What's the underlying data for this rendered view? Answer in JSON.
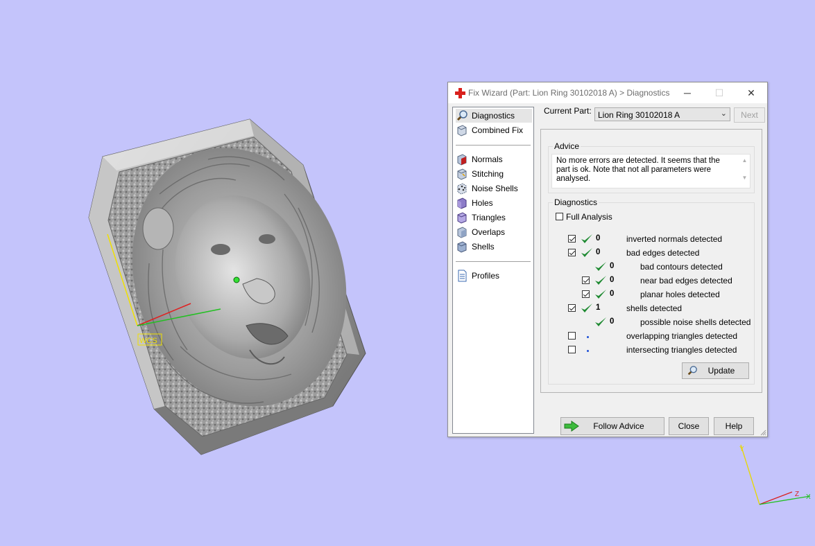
{
  "window": {
    "title": "Fix Wizard (Part: Lion Ring 30102018 A) > Diagnostics",
    "min_glyph": "─",
    "max_glyph": "☐",
    "close_glyph": "✕"
  },
  "sidebar": {
    "items": [
      {
        "label": "Diagnostics",
        "icon": "magnifier-icon",
        "selected": true
      },
      {
        "label": "Combined Fix",
        "icon": "cube-icon"
      },
      {
        "label": "Normals",
        "icon": "normals-cube-icon"
      },
      {
        "label": "Stitching",
        "icon": "stitching-cube-icon"
      },
      {
        "label": "Noise Shells",
        "icon": "noise-shells-icon"
      },
      {
        "label": "Holes",
        "icon": "holes-cube-icon"
      },
      {
        "label": "Triangles",
        "icon": "triangles-cube-icon"
      },
      {
        "label": "Overlaps",
        "icon": "overlaps-cube-icon"
      },
      {
        "label": "Shells",
        "icon": "shells-cube-icon"
      },
      {
        "label": "Profiles",
        "icon": "document-icon"
      }
    ]
  },
  "current_part": {
    "label": "Current Part:",
    "value": "Lion Ring 30102018 A",
    "next_label": "Next"
  },
  "advice": {
    "title": "Advice",
    "text": "No more errors are detected. It seems that the part is ok. Note that not all parameters were analysed."
  },
  "diagnostics": {
    "title": "Diagnostics",
    "full_analysis_label": "Full Analysis",
    "full_analysis_checked": false,
    "rows": [
      {
        "checkbox": true,
        "checked": true,
        "status": "ok",
        "value": "0",
        "label": "inverted normals detected",
        "indent": 0
      },
      {
        "checkbox": true,
        "checked": true,
        "status": "ok",
        "value": "0",
        "label": "bad edges detected",
        "indent": 0
      },
      {
        "checkbox": false,
        "checked": false,
        "status": "ok",
        "value": "0",
        "label": "bad contours detected",
        "indent": 1
      },
      {
        "checkbox": true,
        "checked": true,
        "status": "ok",
        "value": "0",
        "label": "near bad edges detected",
        "indent": 1
      },
      {
        "checkbox": true,
        "checked": true,
        "status": "ok",
        "value": "0",
        "label": "planar holes detected",
        "indent": 1
      },
      {
        "checkbox": true,
        "checked": true,
        "status": "ok",
        "value": "1",
        "label": "shells detected",
        "indent": 0
      },
      {
        "checkbox": false,
        "checked": false,
        "status": "ok",
        "value": "0",
        "label": "possible noise shells detected",
        "indent": 1
      },
      {
        "checkbox": true,
        "checked": false,
        "status": "none",
        "value": "",
        "label": "overlapping triangles detected",
        "indent": 0
      },
      {
        "checkbox": true,
        "checked": false,
        "status": "none",
        "value": "",
        "label": "intersecting triangles detected",
        "indent": 0
      }
    ],
    "update_label": "Update"
  },
  "footer": {
    "follow_advice_label": "Follow Advice",
    "close_label": "Close",
    "help_label": "Help"
  },
  "viewport": {
    "wcs_label": "WCS",
    "axis_y": "Y",
    "axis_z": "Z",
    "axis_x": "X"
  },
  "colors": {
    "background": "#c4c4fb",
    "check_green": "#1f8a32",
    "app_icon_red": "#d9201c"
  }
}
